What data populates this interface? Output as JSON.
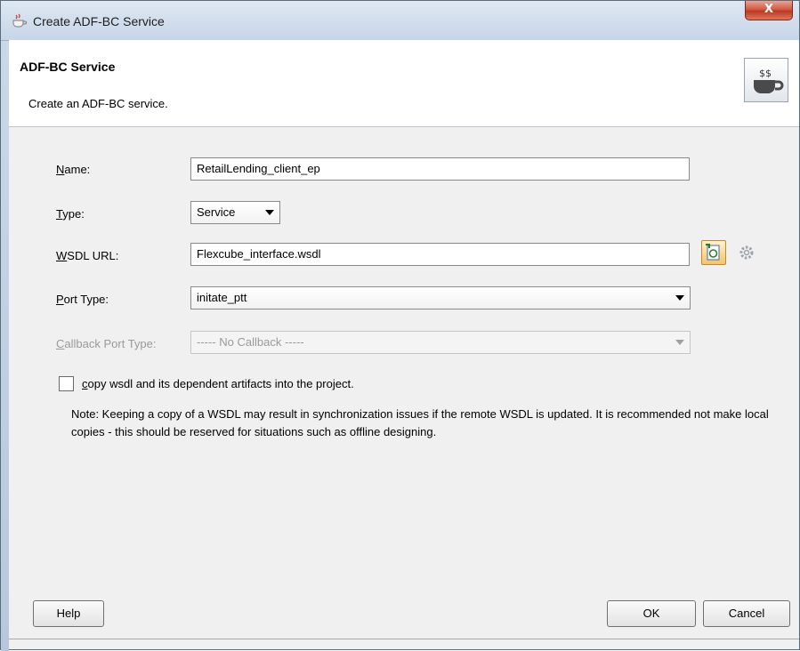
{
  "window": {
    "title": "Create ADF-BC Service",
    "close_label": "X"
  },
  "header": {
    "title": "ADF-BC Service",
    "subtitle": "Create an ADF-BC service."
  },
  "form": {
    "name": {
      "label_key": "N",
      "label_rest": "ame:",
      "value": "RetailLending_client_ep"
    },
    "type": {
      "label_key": "T",
      "label_rest": "ype:",
      "value": "Service"
    },
    "wsdl_url": {
      "label_key": "W",
      "label_rest": "SDL URL:",
      "value": "Flexcube_interface.wsdl"
    },
    "port_type": {
      "label_key": "P",
      "label_rest": "ort Type:",
      "value": "initate_ptt"
    },
    "callback_port_type": {
      "label_key": "C",
      "label_rest": "allback Port Type:",
      "value": "----- No Callback -----"
    },
    "copy_wsdl": {
      "label_key": "c",
      "label_rest": "opy wsdl and its dependent artifacts into the project.",
      "checked": false
    },
    "note": "Note: Keeping a copy of a WSDL may result in synchronization issues if the remote WSDL is updated. It is recommended not make local copies - this should be reserved for situations such as offline designing."
  },
  "buttons": {
    "help": "Help",
    "ok": "OK",
    "cancel": "Cancel"
  },
  "icons": {
    "app": "coffee-cup-icon",
    "header": "java-service-icon",
    "browse": "browse-wsdl-icon",
    "gear": "gear-icon"
  }
}
